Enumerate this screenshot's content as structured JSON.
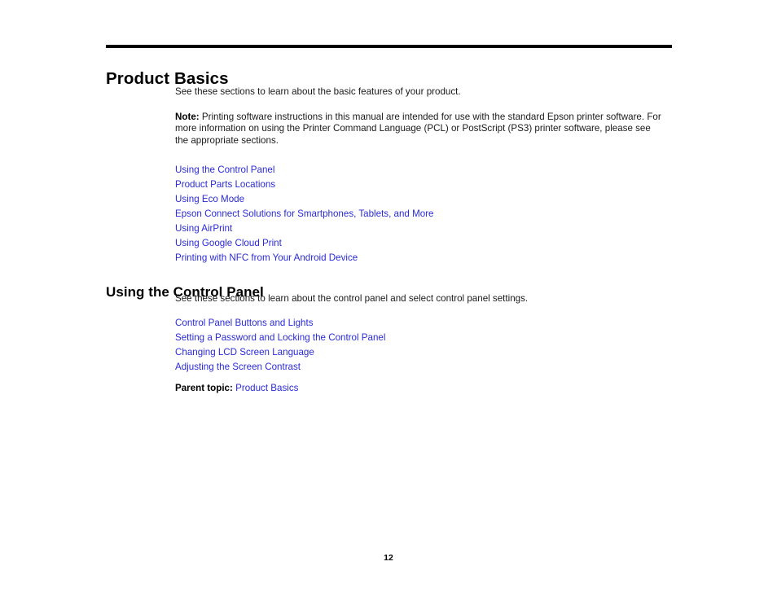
{
  "document": {
    "chapter_title": "Product Basics",
    "intro_paragraph": "See these sections to learn about the basic features of your product.",
    "note": {
      "label": "Note:",
      "text": " Printing software instructions in this manual are intended for use with the standard Epson printer software. For more information on using the Printer Command Language (PCL) or PostScript (PS3) printer software, please see the appropriate sections."
    },
    "toc_links": [
      {
        "label": "Using the Control Panel"
      },
      {
        "label": "Product Parts Locations"
      },
      {
        "label": "Using Eco Mode"
      },
      {
        "label": "Epson Connect Solutions for Smartphones, Tablets, and More"
      },
      {
        "label": "Using AirPrint"
      },
      {
        "label": "Using Google Cloud Print"
      },
      {
        "label": "Printing with NFC from Your Android Device"
      }
    ],
    "sections": [
      {
        "title": "Using the Control Panel",
        "intro": "See these sections to learn about the control panel and select control panel settings.",
        "links": [
          {
            "label": "Control Panel Buttons and Lights"
          },
          {
            "label": "Setting a Password and Locking the Control Panel"
          },
          {
            "label": "Changing LCD Screen Language"
          },
          {
            "label": "Adjusting the Screen Contrast"
          }
        ],
        "parent_topic": {
          "label": "Parent topic:",
          "link": "Product Basics"
        }
      }
    ],
    "page_number": "12",
    "colors": {
      "link": "#2a2ad8",
      "text": "#000000",
      "background": "#ffffff",
      "rule": "#000000"
    }
  }
}
